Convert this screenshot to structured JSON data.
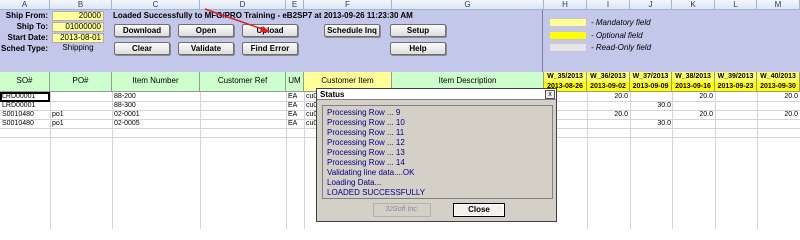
{
  "columns": [
    "A",
    "B",
    "C",
    "D",
    "E",
    "F",
    "G",
    "H",
    "I",
    "J",
    "K",
    "L",
    "M"
  ],
  "header": {
    "ship_from_label": "Ship From:",
    "ship_from_value": "20000",
    "ship_to_label": "Ship To:",
    "ship_to_value": "01000000",
    "start_date_label": "Start Date:",
    "start_date_value": "2013-08-01",
    "sched_type_label": "Sched Type:",
    "sched_type_value": "Shipping",
    "status_message": "Loaded Successfully to MFG/PRO Training - eB2SP7 at 2013-09-26 11:23:30 AM"
  },
  "toolbar": {
    "download": "Download",
    "open": "Open",
    "upload": "Upload",
    "schedule_inq": "Schedule Inq",
    "setup": "Setup",
    "clear": "Clear",
    "validate": "Validate",
    "find_error": "Find Error",
    "help": "Help"
  },
  "legend": {
    "mandatory": "- Mandatory field",
    "optional": "- Optional field",
    "readonly": "- Read-Only field",
    "colors": {
      "mandatory": "#ffff99",
      "optional": "#ffff00",
      "readonly": "#e6e6e6"
    }
  },
  "grid": {
    "headers": [
      "SO#",
      "PO#",
      "Item Number",
      "Customer Ref",
      "UM",
      "Customer Item",
      "Item Description"
    ],
    "weeks": [
      {
        "week": "W_35/2013",
        "date": "2013-08-26"
      },
      {
        "week": "W_36/2013",
        "date": "2013-09-02"
      },
      {
        "week": "W_37/2013",
        "date": "2013-09-09"
      },
      {
        "week": "W_38/2013",
        "date": "2013-09-16"
      },
      {
        "week": "W_39/2013",
        "date": "2013-09-23"
      },
      {
        "week": "W_40/2013",
        "date": "2013-09-30"
      }
    ],
    "rows": [
      {
        "so": "LRD00001",
        "po": "",
        "item": "88-200",
        "um": "EA",
        "cust_item": "cu0",
        "q2": "20.0",
        "q3": "",
        "q4": "20.0",
        "q5": "",
        "q6": "20.0"
      },
      {
        "so": "LRD00001",
        "po": "",
        "item": "88-300",
        "um": "EA",
        "cust_item": "cu0",
        "q2": "",
        "q3": "30.0",
        "q4": "",
        "q5": "",
        "q6": ""
      },
      {
        "so": "S0010480",
        "po": "po1",
        "item": "02-0001",
        "um": "EA",
        "cust_item": "cu0",
        "q2": "20.0",
        "q3": "",
        "q4": "20.0",
        "q5": "",
        "q6": "20.0"
      },
      {
        "so": "S0010480",
        "po": "po1",
        "item": "02-0005",
        "um": "EA",
        "cust_item": "cu0",
        "q2": "",
        "q3": "30.0",
        "q4": "",
        "q5": "",
        "q6": ""
      }
    ]
  },
  "dialog": {
    "title": "Status",
    "lines": [
      "Processing Row ... 9",
      "Processing Row ... 10",
      "Processing Row ... 11",
      "Processing Row ... 12",
      "Processing Row ... 13",
      "Processing Row ... 14",
      "Validating line data....OK",
      "Loading Data...",
      "LOADED SUCCESSFULLY"
    ],
    "logo_text": "32Soft Inc.",
    "close_label": "Close",
    "close_x": "x"
  }
}
